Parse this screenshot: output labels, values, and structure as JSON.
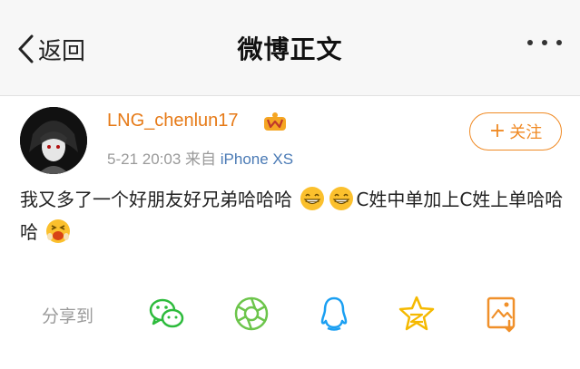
{
  "nav": {
    "back_label": "返回",
    "title": "微博正文"
  },
  "post": {
    "username": "LNG_chenlun17",
    "time": "5-21 20:03",
    "source_prefix": "来自",
    "source": "iPhone XS",
    "follow_label": "关注",
    "content_part1": "我又多了一个好朋友好兄弟哈哈哈",
    "content_part2": "C姓中单加上C姓上单哈哈哈"
  },
  "share": {
    "label": "分享到",
    "targets": [
      "wechat-icon",
      "moments-icon",
      "qq-icon",
      "qzone-icon",
      "save-image-icon"
    ]
  },
  "colors": {
    "username": "#e67a17",
    "follow": "#f08a24",
    "wechat": "#2dbb3c",
    "moments": "#6cc54b",
    "qq": "#1a9ff2",
    "qzone": "#f5b900",
    "save": "#f0902a"
  }
}
